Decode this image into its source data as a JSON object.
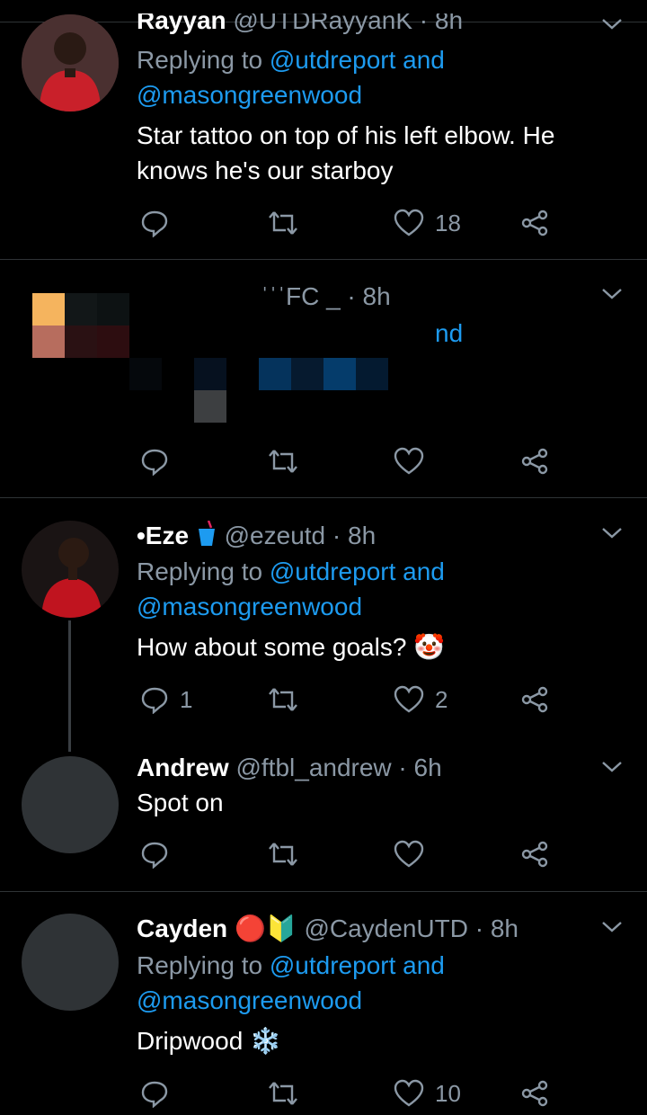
{
  "tweets": [
    {
      "name": "Rayyan",
      "handle": "@UTDRayyanK",
      "time": "8h",
      "meta": "@UTDRayyanK · 8h",
      "replying_prefix": "Replying to",
      "replying_line1": "@utdreport and",
      "replying_line2": "@masongreenwood",
      "text_line1": "Star tattoo on top of his left elbow. He",
      "text_line2": "knows he's our starboy",
      "replies": "",
      "likes": "18"
    },
    {
      "name": "",
      "meta": "ˈˈˈFC _ · 8h",
      "replying_fragment": "nd",
      "likes": ""
    },
    {
      "name": "•Eze",
      "handle": "@ezeutd",
      "time": "8h",
      "meta": "@ezeutd · 8h",
      "replying_prefix": "Replying to",
      "replying_line1": "@utdreport and",
      "replying_line2": "@masongreenwood",
      "text": "How about some goals? 🤡",
      "replies": "1",
      "likes": "2"
    },
    {
      "name": "Andrew",
      "handle": "@ftbl_andrew",
      "time": "6h",
      "meta": "@ftbl_andrew · 6h",
      "text": "Spot on",
      "replies": "",
      "likes": ""
    },
    {
      "name": "Cayden",
      "badges": "🔴🔰",
      "handle": "@CaydenUTD",
      "time": "8h",
      "meta": "@CaydenUTD · 8h",
      "replying_prefix": "Replying to",
      "replying_line1": "@utdreport and",
      "replying_line2": "@masongreenwood",
      "text": "Dripwood ❄️",
      "replies": "",
      "likes": "10"
    }
  ],
  "icons": {
    "reply": "reply-icon",
    "retweet": "retweet-icon",
    "like": "heart-icon",
    "share": "share-icon",
    "more": "chevron-down-icon"
  },
  "colors": {
    "background": "#000000",
    "link": "#1d9bf0",
    "secondary": "#8b98a5",
    "divider": "#2f3336"
  }
}
